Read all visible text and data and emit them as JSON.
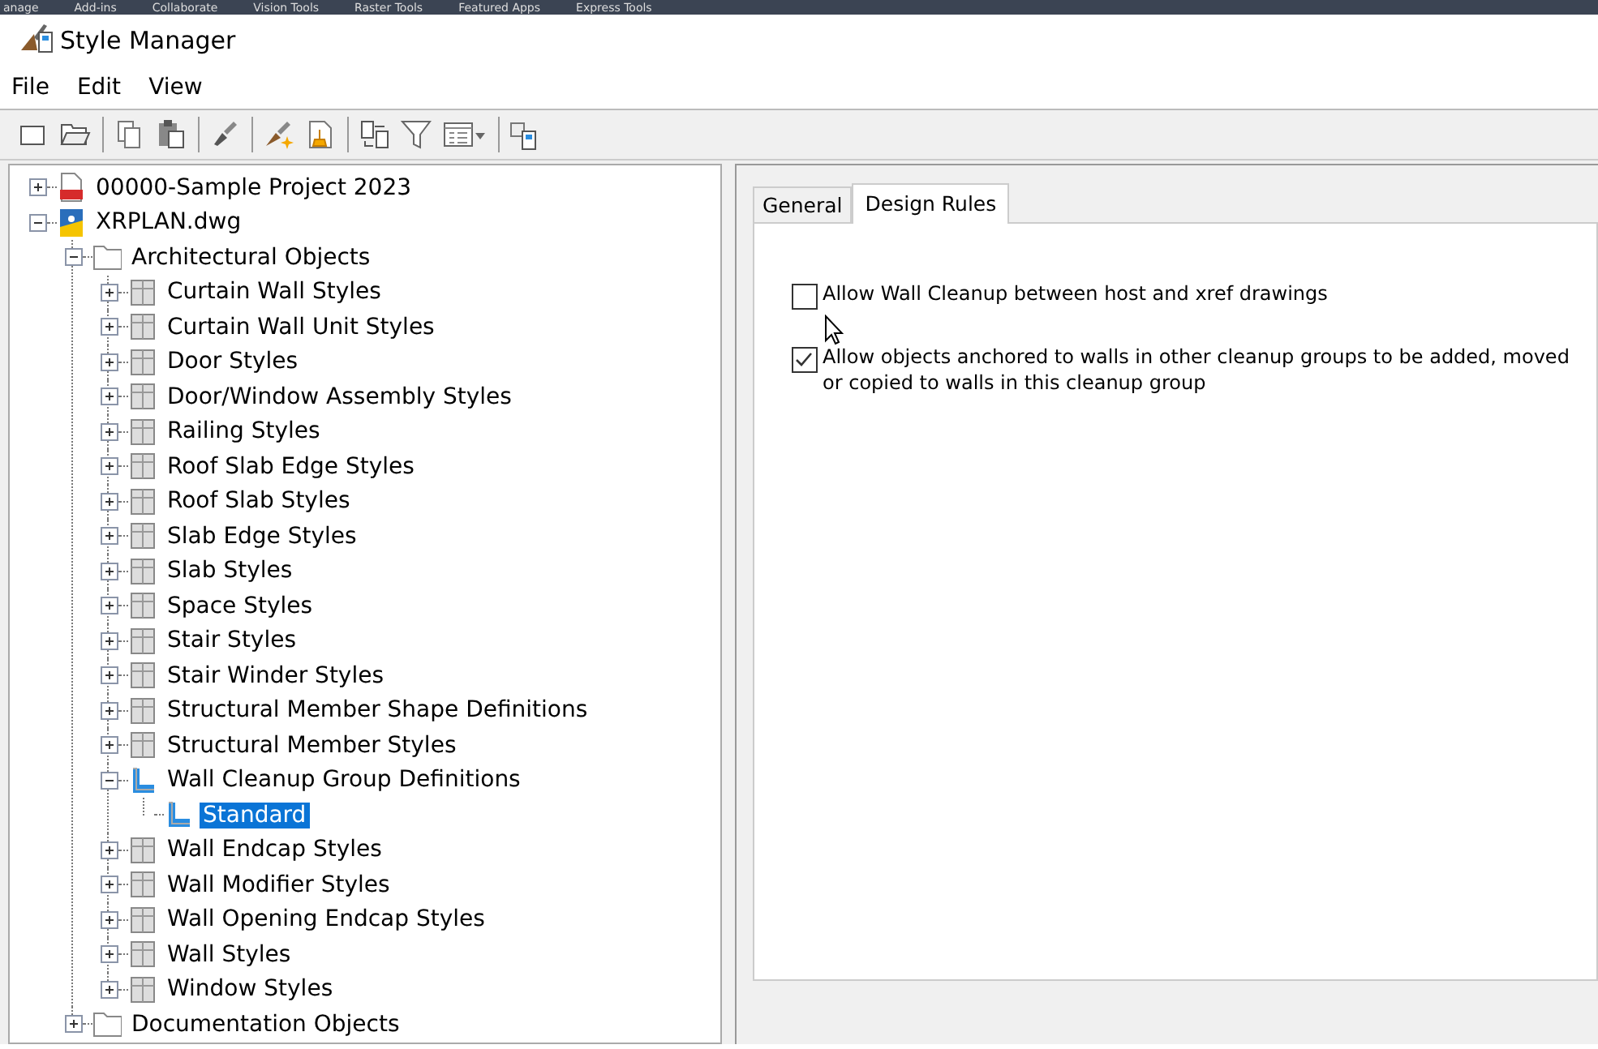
{
  "background_ribbon": {
    "tabs": [
      "anage",
      "Add-ins",
      "Collaborate",
      "Vision Tools",
      "Raster Tools",
      "Featured Apps",
      "Express Tools"
    ]
  },
  "window": {
    "title": "Style Manager"
  },
  "menu": [
    "File",
    "Edit",
    "View"
  ],
  "toolbar": [
    {
      "kind": "new"
    },
    {
      "kind": "open"
    },
    {
      "kind": "sep"
    },
    {
      "kind": "copy"
    },
    {
      "kind": "paste"
    },
    {
      "kind": "sep"
    },
    {
      "kind": "edit"
    },
    {
      "kind": "sep"
    },
    {
      "kind": "newstyle"
    },
    {
      "kind": "purge"
    },
    {
      "kind": "sep"
    },
    {
      "kind": "compare"
    },
    {
      "kind": "filter"
    },
    {
      "kind": "view"
    },
    {
      "kind": "sep"
    },
    {
      "kind": "toggle"
    }
  ],
  "tree": [
    {
      "label": "00000-Sample Project 2023",
      "kind": "project",
      "expanded": false,
      "selected": false
    },
    {
      "label": "XRPLAN.dwg",
      "kind": "drawing",
      "expanded": true,
      "selected": false,
      "children": [
        {
          "label": "Architectural Objects",
          "kind": "folder",
          "expanded": true,
          "selected": false,
          "children": [
            {
              "label": "Curtain Wall Styles",
              "kind": "style",
              "expanded": false,
              "selected": false
            },
            {
              "label": "Curtain Wall Unit Styles",
              "kind": "style",
              "expanded": false,
              "selected": false
            },
            {
              "label": "Door Styles",
              "kind": "style",
              "expanded": false,
              "selected": false
            },
            {
              "label": "Door/Window Assembly Styles",
              "kind": "style",
              "expanded": false,
              "selected": false
            },
            {
              "label": "Railing Styles",
              "kind": "style",
              "expanded": false,
              "selected": false
            },
            {
              "label": "Roof Slab Edge Styles",
              "kind": "style",
              "expanded": false,
              "selected": false
            },
            {
              "label": "Roof Slab Styles",
              "kind": "style",
              "expanded": false,
              "selected": false
            },
            {
              "label": "Slab Edge Styles",
              "kind": "style",
              "expanded": false,
              "selected": false
            },
            {
              "label": "Slab Styles",
              "kind": "style",
              "expanded": false,
              "selected": false
            },
            {
              "label": "Space Styles",
              "kind": "style",
              "expanded": false,
              "selected": false
            },
            {
              "label": "Stair Styles",
              "kind": "style",
              "expanded": false,
              "selected": false
            },
            {
              "label": "Stair Winder Styles",
              "kind": "style",
              "expanded": false,
              "selected": false
            },
            {
              "label": "Structural Member Shape Definitions",
              "kind": "style",
              "expanded": false,
              "selected": false
            },
            {
              "label": "Structural Member Styles",
              "kind": "style",
              "expanded": false,
              "selected": false
            },
            {
              "label": "Wall Cleanup Group Definitions",
              "kind": "cleanup",
              "expanded": true,
              "selected": false,
              "children": [
                {
                  "label": "Standard",
                  "kind": "cleanup",
                  "selected": true
                }
              ]
            },
            {
              "label": "Wall Endcap Styles",
              "kind": "style",
              "expanded": false,
              "selected": false
            },
            {
              "label": "Wall Modifier Styles",
              "kind": "style",
              "expanded": false,
              "selected": false
            },
            {
              "label": "Wall Opening Endcap Styles",
              "kind": "style",
              "expanded": false,
              "selected": false
            },
            {
              "label": "Wall Styles",
              "kind": "style",
              "expanded": false,
              "selected": false
            },
            {
              "label": "Window Styles",
              "kind": "style",
              "expanded": false,
              "selected": false
            }
          ]
        },
        {
          "label": "Documentation Objects",
          "kind": "folder",
          "expanded": false,
          "selected": false
        }
      ]
    }
  ],
  "tabs": [
    {
      "label": "General",
      "selected": false
    },
    {
      "label": "Design Rules",
      "selected": true
    }
  ],
  "options": [
    {
      "label": "Allow Wall Cleanup between host and xref drawings",
      "checked": false
    },
    {
      "label": "Allow objects anchored to walls in other cleanup groups to be added, moved or copied to walls in this cleanup group",
      "checked": true
    }
  ]
}
